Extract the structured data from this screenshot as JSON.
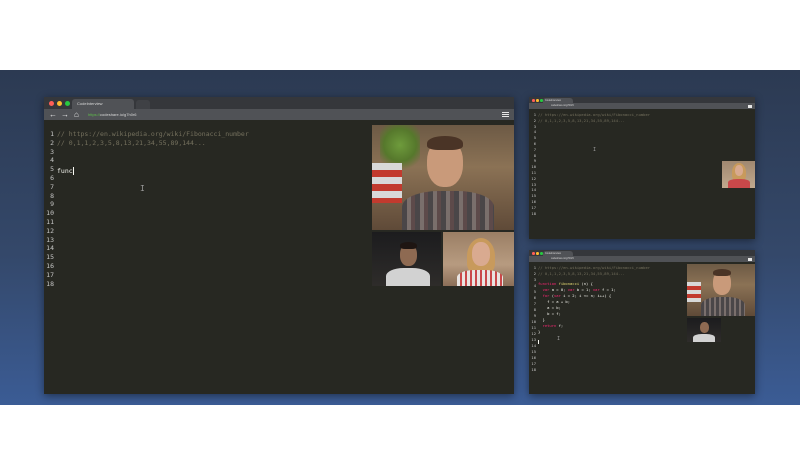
{
  "main_window": {
    "tab_title": "CodeInterview",
    "url_secure": "https://",
    "url_rest": "codeshare.io/g7h0r6",
    "lines": [
      [
        {
          "t": "// https://en.wikipedia.org/wiki/Fibonacci_number",
          "c": "cmt"
        }
      ],
      [
        {
          "t": "// 0,1,1,2,3,5,8,13,21,34,55,89,144...",
          "c": "cmt"
        }
      ],
      [],
      [],
      [],
      [
        {
          "t": "func",
          "c": "plain"
        }
      ],
      [],
      [],
      [],
      [],
      [],
      [],
      [],
      [],
      [],
      [],
      [],
      []
    ]
  },
  "top_right_window": {
    "tab_title": "CodeInterview",
    "url": "codeshare.io/g7h0r6",
    "lines": [
      [
        {
          "t": "// https://en.wikipedia.org/wiki/Fibonacci_number",
          "c": "cmt"
        }
      ],
      [
        {
          "t": "// 0,1,1,2,3,5,8,13,21,34,55,89,144...",
          "c": "cmt"
        }
      ],
      [],
      [],
      [],
      [],
      [],
      [],
      [],
      [],
      [],
      [],
      [],
      [],
      [],
      [],
      [],
      []
    ]
  },
  "bottom_right_window": {
    "tab_title": "CodeInterview",
    "url": "codeshare.io/g7h0r6",
    "lines": [
      [
        {
          "t": "// https://en.wikipedia.org/wiki/Fibonacci_number",
          "c": "cmt"
        }
      ],
      [
        {
          "t": "// 0,1,1,2,3,5,8,13,21,34,55,89,144...",
          "c": "cmt"
        }
      ],
      [],
      [
        {
          "t": "function ",
          "c": "kw"
        },
        {
          "t": "fibonacci",
          "c": "fn"
        },
        {
          "t": " (n) {",
          "c": "plain"
        }
      ],
      [
        {
          "t": "  ",
          "c": "plain"
        },
        {
          "t": "var",
          "c": "kw"
        },
        {
          "t": " a = 0; ",
          "c": "plain"
        },
        {
          "t": "var",
          "c": "kw"
        },
        {
          "t": " b = 1; ",
          "c": "plain"
        },
        {
          "t": "var",
          "c": "kw"
        },
        {
          "t": " f = 1;",
          "c": "plain"
        }
      ],
      [
        {
          "t": "  ",
          "c": "plain"
        },
        {
          "t": "for",
          "c": "kw"
        },
        {
          "t": " (",
          "c": "plain"
        },
        {
          "t": "var",
          "c": "kw"
        },
        {
          "t": " i = 2; i <= n; i++) {",
          "c": "plain"
        }
      ],
      [
        {
          "t": "    f = a + b;",
          "c": "plain"
        }
      ],
      [
        {
          "t": "    a = b;",
          "c": "plain"
        }
      ],
      [
        {
          "t": "    b = f;",
          "c": "plain"
        }
      ],
      [
        {
          "t": "  }",
          "c": "plain"
        }
      ],
      [
        {
          "t": "  ",
          "c": "plain"
        },
        {
          "t": "return",
          "c": "kw"
        },
        {
          "t": " f;",
          "c": "plain"
        }
      ],
      [
        {
          "t": "}",
          "c": "plain"
        }
      ],
      [],
      [],
      [],
      [],
      [],
      []
    ]
  },
  "icons": {
    "back": "←",
    "forward": "→",
    "home": "⌂",
    "ibeam": "I",
    "lock": "🔒"
  },
  "colors": {
    "band_top": "#2c3a52",
    "band_bottom": "#3b5c95",
    "editor_bg": "#272822",
    "comment": "#75715e",
    "keyword": "#f92672",
    "function": "#e6db74"
  }
}
